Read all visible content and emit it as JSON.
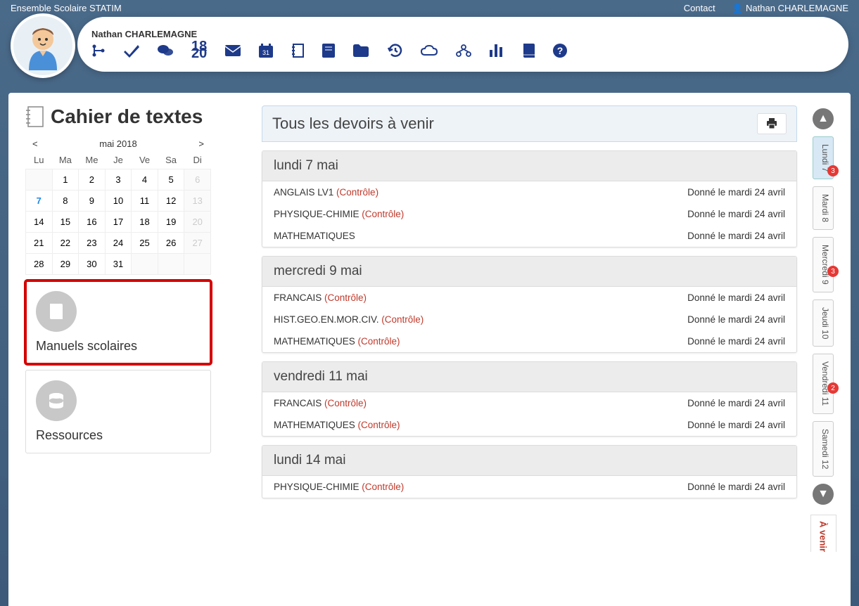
{
  "topbar": {
    "school": "Ensemble Scolaire STATIM",
    "contact": "Contact",
    "user": "Nathan CHARLEMAGNE"
  },
  "header": {
    "name": "Nathan CHARLEMAGNE",
    "icons": [
      "branch",
      "check",
      "chat",
      "grade",
      "mail",
      "calendar",
      "notebook",
      "book",
      "folder",
      "history",
      "cloud",
      "group",
      "stats",
      "textbook",
      "help"
    ]
  },
  "page": {
    "title": "Cahier de textes"
  },
  "calendar": {
    "prev": "<",
    "next": ">",
    "month": "mai 2018",
    "dow": [
      "Lu",
      "Ma",
      "Me",
      "Je",
      "Ve",
      "Sa",
      "Di"
    ],
    "weeks": [
      [
        {
          "d": "",
          "dim": true
        },
        {
          "d": "1"
        },
        {
          "d": "2"
        },
        {
          "d": "3"
        },
        {
          "d": "4"
        },
        {
          "d": "5"
        },
        {
          "d": "6",
          "dim": true
        }
      ],
      [
        {
          "d": "7",
          "sel": true
        },
        {
          "d": "8"
        },
        {
          "d": "9"
        },
        {
          "d": "10"
        },
        {
          "d": "11"
        },
        {
          "d": "12"
        },
        {
          "d": "13",
          "dim": true
        }
      ],
      [
        {
          "d": "14"
        },
        {
          "d": "15"
        },
        {
          "d": "16"
        },
        {
          "d": "17"
        },
        {
          "d": "18"
        },
        {
          "d": "19"
        },
        {
          "d": "20",
          "dim": true
        }
      ],
      [
        {
          "d": "21"
        },
        {
          "d": "22"
        },
        {
          "d": "23"
        },
        {
          "d": "24"
        },
        {
          "d": "25"
        },
        {
          "d": "26"
        },
        {
          "d": "27",
          "dim": true
        }
      ],
      [
        {
          "d": "28"
        },
        {
          "d": "29"
        },
        {
          "d": "30"
        },
        {
          "d": "31"
        },
        {
          "d": "",
          "dim": true
        },
        {
          "d": "",
          "dim": true
        },
        {
          "d": "",
          "dim": true
        }
      ]
    ]
  },
  "side": {
    "manuels": "Manuels scolaires",
    "ressources": "Ressources"
  },
  "panel": {
    "title": "Tous les devoirs à venir"
  },
  "controle_label": "(Contrôle)",
  "days": [
    {
      "title": "lundi 7 mai",
      "items": [
        {
          "subj": "ANGLAIS LV1",
          "ctrl": true,
          "given": "Donné le mardi 24 avril"
        },
        {
          "subj": "PHYSIQUE-CHIMIE",
          "ctrl": true,
          "given": "Donné le mardi 24 avril"
        },
        {
          "subj": "MATHEMATIQUES",
          "ctrl": false,
          "given": "Donné le mardi 24 avril"
        }
      ]
    },
    {
      "title": "mercredi 9 mai",
      "items": [
        {
          "subj": "FRANCAIS",
          "ctrl": true,
          "given": "Donné le mardi 24 avril"
        },
        {
          "subj": "HIST.GEO.EN.MOR.CIV.",
          "ctrl": true,
          "given": "Donné le mardi 24 avril"
        },
        {
          "subj": "MATHEMATIQUES",
          "ctrl": true,
          "given": "Donné le mardi 24 avril"
        }
      ]
    },
    {
      "title": "vendredi 11 mai",
      "items": [
        {
          "subj": "FRANCAIS",
          "ctrl": true,
          "given": "Donné le mardi 24 avril"
        },
        {
          "subj": "MATHEMATIQUES",
          "ctrl": true,
          "given": "Donné le mardi 24 avril"
        }
      ]
    },
    {
      "title": "lundi 14 mai",
      "items": [
        {
          "subj": "PHYSIQUE-CHIMIE",
          "ctrl": true,
          "given": "Donné le mardi 24 avril"
        }
      ]
    }
  ],
  "rail": {
    "tabs": [
      {
        "label": "Lundi 7",
        "badge": "3",
        "active": true
      },
      {
        "label": "Mardi 8"
      },
      {
        "label": "Mercredi 9",
        "badge": "3"
      },
      {
        "label": "Jeudi 10"
      },
      {
        "label": "Vendredi 11",
        "badge": "2"
      },
      {
        "label": "Samedi 12"
      }
    ],
    "avenir": "À venir"
  }
}
